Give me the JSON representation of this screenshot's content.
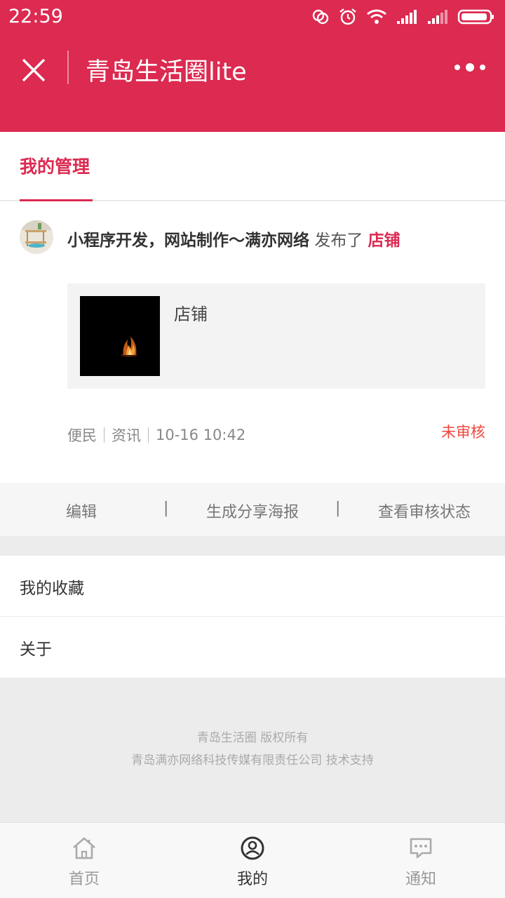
{
  "status_bar": {
    "time": "22:59"
  },
  "nav": {
    "title": "青岛生活圈lite"
  },
  "tab": {
    "active": "我的管理"
  },
  "post": {
    "author": "小程序开发，网站制作～满亦网络",
    "verb": "发布了",
    "type": "店铺",
    "preview_title": "店铺",
    "category": "便民",
    "section": "资讯",
    "datetime": "10-16 10:42",
    "status": "未审核"
  },
  "actions": {
    "edit": "编辑",
    "poster": "生成分享海报",
    "review": "查看审核状态",
    "sep": "|"
  },
  "menu": {
    "items": [
      {
        "label": "我的收藏"
      },
      {
        "label": "关于"
      }
    ]
  },
  "footer": {
    "line1": "青岛生活圈 版权所有",
    "line2": "青岛满亦网络科技传媒有限责任公司 技术支持"
  },
  "bottom_tabs": {
    "home": "首页",
    "mine": "我的",
    "notify": "通知"
  },
  "colors": {
    "brand": "#dc2a51",
    "status_red": "#f3453c"
  }
}
